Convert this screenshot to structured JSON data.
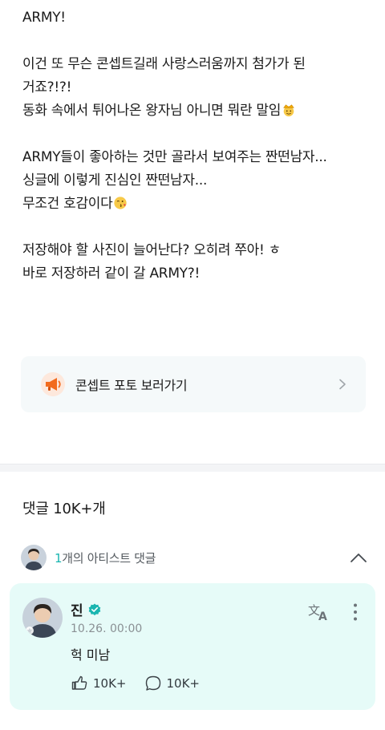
{
  "post": {
    "lines": [
      "ARMY!",
      "",
      "이건 또 무슨 콘셉트길래 사랑스러움까지 첨가가 된",
      "거죠?!?!",
      "동화 속에서 튀어나온 왕자님 아니면 뭐란 말임",
      "",
      "ARMY들이 좋아하는 것만 골라서 보여주는 짠떤남자...",
      "싱글에 이렇게 진심인 짠떤남자...",
      "무조건 호감이다",
      "",
      "저장해야 할 사진이 늘어난다? 오히려 쭈아! ㅎ",
      "바로 저장하러 같이 갈 ARMY?!"
    ],
    "emoji_after_line_4": "crown-emoji",
    "emoji_after_line_8": "kiss-emoji"
  },
  "banner": {
    "label": "콘셉트 포토 보러가기",
    "icon": "megaphone-icon"
  },
  "comments": {
    "header": "댓글 10K+개",
    "artist_count": "1",
    "artist_label": "개의 아티스트 댓글"
  },
  "artist_comment": {
    "author": "진",
    "timestamp": "10.26. 00:00",
    "text": "헉 미남",
    "likes": "10K+",
    "replies": "10K+"
  },
  "colors": {
    "accent": "#19b5b0",
    "card_bg": "#e6fbf8",
    "banner_bg": "#f5f9fa",
    "megaphone": "#f26b1d"
  }
}
